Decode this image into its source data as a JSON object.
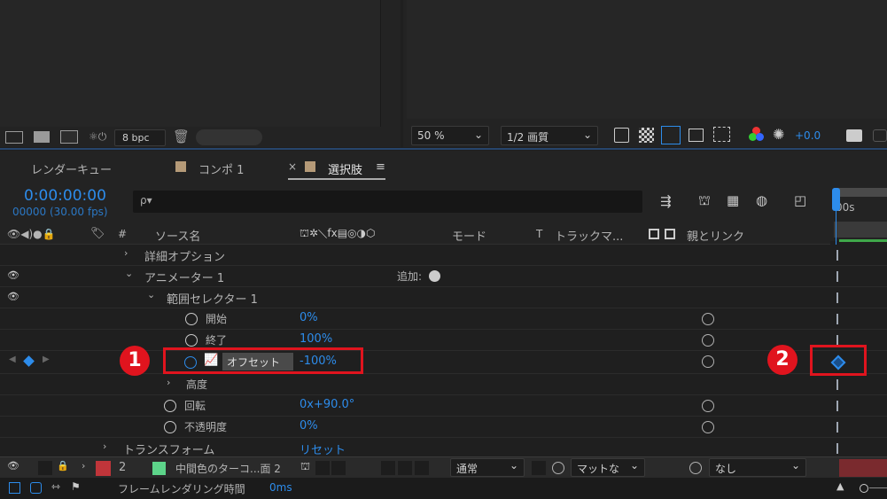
{
  "top_left_toolbar": {
    "bpc": "8 bpc"
  },
  "viewer_toolbar": {
    "zoom": "50 %",
    "quality": "1/2 画質",
    "exposure": "+0.0"
  },
  "tabs": [
    {
      "label": "レンダーキュー"
    },
    {
      "label": "コンポ 1"
    },
    {
      "label": "選択肢",
      "close": "×",
      "menu": "≡"
    }
  ],
  "timecode": {
    "main": "0:00:00:00",
    "sub": "00000 (30.00 fps)"
  },
  "ruler_label": "00s",
  "search": {
    "placeholder": "",
    "icon": "ρ▾"
  },
  "columns": {
    "hash": "#",
    "source_name": "ソース名",
    "mode": "モード",
    "t": "T",
    "track_matte": "トラックマ...",
    "parent_link": "親とリンク"
  },
  "rows": {
    "detail_options": "詳細オプション",
    "animator": "アニメーター 1",
    "add_label": "追加:",
    "range_selector": "範囲セレクター 1",
    "start": {
      "label": "開始",
      "value": "0%"
    },
    "end": {
      "label": "終了",
      "value": "100%"
    },
    "offset": {
      "label": "オフセット",
      "value": "-100%"
    },
    "height": "高度",
    "rotation": {
      "label": "回転",
      "value": "0x+90.0°"
    },
    "opacity": {
      "label": "不透明度",
      "value": "0%"
    },
    "transform": {
      "label": "トランスフォーム",
      "value": "リセット"
    }
  },
  "layer": {
    "number": "2",
    "name": "中間色のターコ...面 2",
    "mode": "通常",
    "matte": "マットな",
    "parent": "なし",
    "label_color": "#c0353a",
    "swatch_color": "#5dd48a"
  },
  "status_bar": {
    "label": "フレームレンダリング時間",
    "value": "0ms"
  },
  "annotations": {
    "badge1": "1",
    "badge2": "2"
  },
  "colors": {
    "accent": "#2d8ceb",
    "highlight": "#e0141e",
    "panel": "#1f1f1f"
  }
}
